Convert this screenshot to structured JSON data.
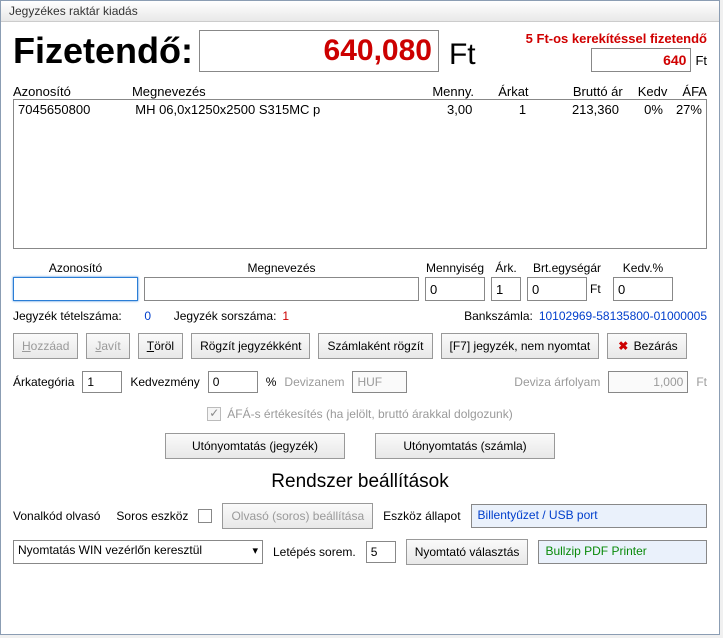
{
  "title": "Jegyzékes raktár kiadás",
  "pay": {
    "label": "Fizetendő:",
    "amount": "640,080",
    "ft": "Ft",
    "roundlabel": "5 Ft-os kerekítéssel fizetendő",
    "rounded": "640"
  },
  "hdr": {
    "azon": "Azonosító",
    "meg": "Megnevezés",
    "menny": "Menny.",
    "arkat": "Árkat",
    "brutto": "Bruttó ár",
    "kedv": "Kedv",
    "afa": "ÁFA"
  },
  "row": {
    "azon": "7045650800",
    "meg": "MH 06,0x1250x2500 S315MC p",
    "menny": "3,00",
    "arkat": "1",
    "brutto": "213,360",
    "kedv": "0%",
    "afa": "27%"
  },
  "fld": {
    "azon": "Azonosító",
    "meg": "Megnevezés",
    "menny": "Mennyiség",
    "ark": "Árk.",
    "brt": "Brt.egységár",
    "kedv": "Kedv.%",
    "v_azon": "",
    "v_meg": "",
    "v_menny": "0",
    "v_ark": "1",
    "v_brt": "0",
    "ft": "Ft",
    "v_kedv": "0"
  },
  "line2": {
    "tetl": "Jegyzék tételszáma:",
    "tetv": "0",
    "sorl": "Jegyzék sorszáma:",
    "sorv": "1",
    "bankl": "Bankszámla:",
    "bankv": "10102969-58135800-01000005"
  },
  "btns": {
    "hozzaad": "Hozzáad",
    "javit": "Javít",
    "torol": "Töröl",
    "rogzitj": "Rögzít jegyzékként",
    "szaml": "Számlaként rögzít",
    "f7": "[F7] jegyzék, nem nyomtat",
    "bezar": "Bezárás"
  },
  "row3": {
    "arkat": "Árkategória",
    "arkatv": "1",
    "kedv": "Kedvezmény",
    "kedvv": "0",
    "pct": "%",
    "devnem": "Devizanem",
    "devnemv": "HUF",
    "darf": "Deviza árfolyam",
    "darfv": "1,000",
    "ft": "Ft"
  },
  "afa": "ÁFÁ-s értékesítés (ha jelölt, bruttó árakkal dolgozunk)",
  "print": {
    "j": "Utónyomtatás (jegyzék)",
    "s": "Utónyomtatás (számla)"
  },
  "section": "Rendszer beállítások",
  "row4": {
    "vonal": "Vonalkód olvasó",
    "soros": "Soros eszköz",
    "olvbtn": "Olvasó (soros) beállítása",
    "eszall": "Eszköz állapot",
    "eszv": "Billentyűzet / USB port"
  },
  "row5": {
    "sel": "Nyomtatás WIN vezérlőn keresztül",
    "letep": "Letépés sorem.",
    "letepv": "5",
    "nyombtn": "Nyomtató választás",
    "nyomv": "Bullzip PDF Printer"
  }
}
